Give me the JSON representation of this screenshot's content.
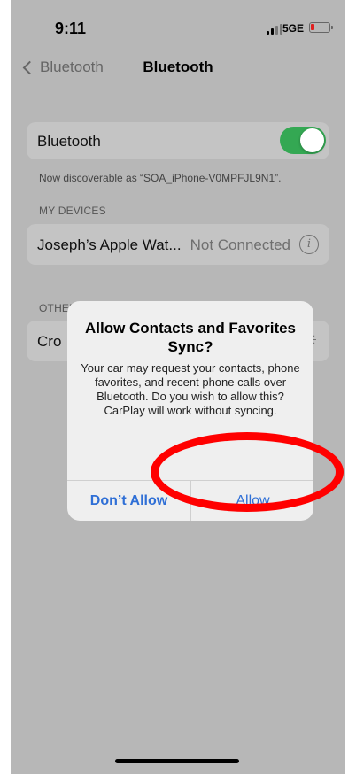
{
  "status_bar": {
    "time": "9:11",
    "network": "5GE"
  },
  "nav": {
    "back_label": "Bluetooth",
    "title": "Bluetooth"
  },
  "bluetooth_row": {
    "label": "Bluetooth",
    "toggle_on": true
  },
  "discoverable_text": "Now discoverable as “SOA_iPhone-V0MPFJL9N1”.",
  "my_devices": {
    "header": "MY DEVICES",
    "items": [
      {
        "name": "Joseph’s Apple Wat...",
        "status": "Not Connected"
      }
    ]
  },
  "other_devices": {
    "header": "OTHER DEVICES",
    "items": [
      {
        "name": "Cro"
      }
    ]
  },
  "dialog": {
    "title": "Allow Contacts and Favorites Sync?",
    "message": "Your car may request your contacts, phone favorites, and recent phone calls over Bluetooth. Do you wish to allow this? CarPlay will work without syncing.",
    "dont_allow_label": "Don’t Allow",
    "allow_label": "Allow"
  },
  "colors": {
    "toggle_on": "#34a853",
    "link_blue": "#2f6fd6",
    "annotation_red": "#ff0000"
  },
  "icons": {
    "back": "chevron-left-icon",
    "info": "info-icon",
    "spinner": "spinner-icon"
  }
}
